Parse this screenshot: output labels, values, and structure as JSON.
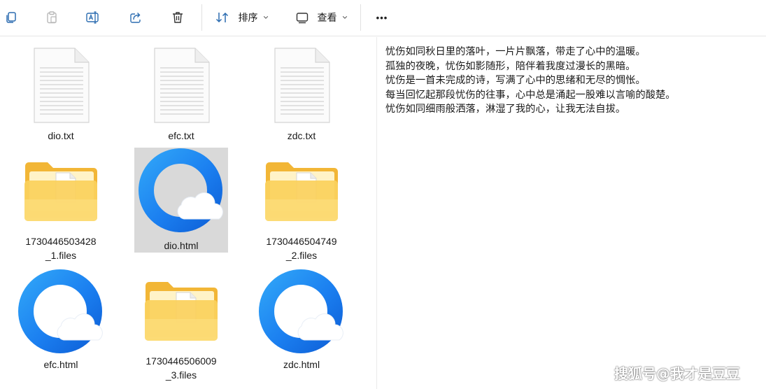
{
  "toolbar": {
    "sort_label": "排序",
    "view_label": "查看",
    "more_label": "•••"
  },
  "files": [
    {
      "name": "dio.txt",
      "type": "text-file"
    },
    {
      "name": "efc.txt",
      "type": "text-file"
    },
    {
      "name": "zdc.txt",
      "type": "text-file"
    },
    {
      "name": "1730446503428_1.files",
      "name_line1": "1730446503428",
      "name_line2": "_1.files",
      "type": "folder"
    },
    {
      "name": "dio.html",
      "type": "html-file",
      "selected": true
    },
    {
      "name": "1730446504749_2.files",
      "name_line1": "1730446504749",
      "name_line2": "_2.files",
      "type": "folder"
    },
    {
      "name": "efc.html",
      "type": "html-file"
    },
    {
      "name": "1730446506009_3.files",
      "name_line1": "1730446506009",
      "name_line2": "_3.files",
      "type": "folder"
    },
    {
      "name": "zdc.html",
      "type": "html-file"
    }
  ],
  "preview": {
    "lines": [
      "忧伤如同秋日里的落叶，一片片飘落，带走了心中的温暖。",
      "孤独的夜晚，忧伤如影随形，陪伴着我度过漫长的黑暗。",
      "忧伤是一首未完成的诗，写满了心中的思绪和无尽的惆怅。",
      "每当回忆起那段忧伤的往事，心中总是涌起一股难以言喻的酸楚。",
      "忧伤如同细雨般洒落，淋湿了我的心，让我无法自拔。"
    ]
  },
  "watermark": "搜狐号@我才是豆豆",
  "colors": {
    "accent_blue": "#1a73e8",
    "folder_yellow": "#f7c948",
    "selection_gray": "#d9d9d9"
  }
}
